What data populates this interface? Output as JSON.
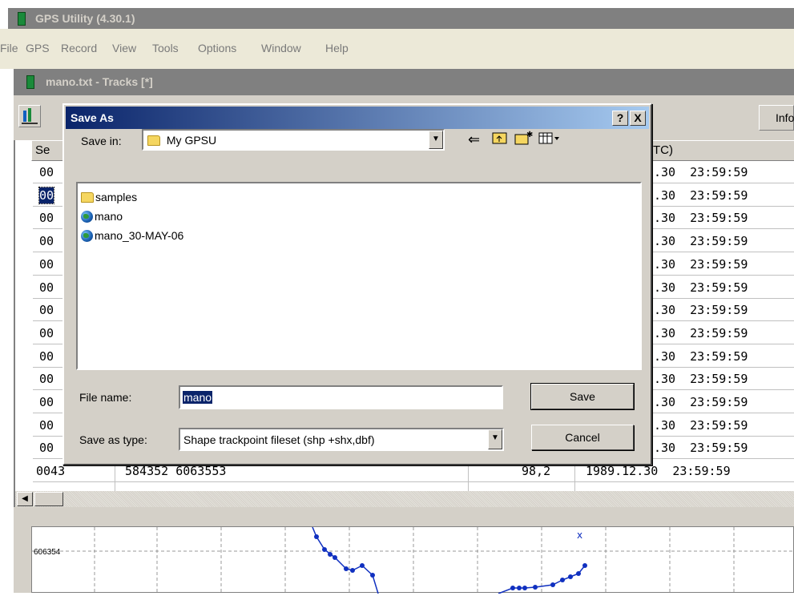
{
  "app": {
    "title": "GPS Utility (4.30.1)",
    "menu": [
      "File",
      "GPS",
      "Record",
      "View",
      "Tools",
      "Options",
      "Window",
      "Help"
    ]
  },
  "child_window": {
    "title": "mano.txt - Tracks [*]",
    "info_button": "Info",
    "columns": {
      "seg": "Se",
      "time": "TC)"
    },
    "rows": [
      {
        "id": "00",
        "time": ".30  23:59:59"
      },
      {
        "id": "00",
        "time": ".30  23:59:59",
        "selected": true
      },
      {
        "id": "00",
        "time": ".30  23:59:59"
      },
      {
        "id": "00",
        "time": ".30  23:59:59"
      },
      {
        "id": "00",
        "time": ".30  23:59:59"
      },
      {
        "id": "00",
        "time": ".30  23:59:59"
      },
      {
        "id": "00",
        "time": ".30  23:59:59"
      },
      {
        "id": "00",
        "time": ".30  23:59:59"
      },
      {
        "id": "00",
        "time": ".30  23:59:59"
      },
      {
        "id": "00",
        "time": ".30  23:59:59"
      },
      {
        "id": "00",
        "time": ".30  23:59:59"
      },
      {
        "id": "00",
        "time": ".30  23:59:59"
      },
      {
        "id": "00",
        "time": ".30  23:59:59"
      }
    ],
    "last_row": {
      "id": "0043",
      "coords": "584352 6063553",
      "alt": "98,2",
      "time": "1989.12.30  23:59:59"
    },
    "plot": {
      "y_tick": "606354"
    }
  },
  "dialog": {
    "title": "Save As",
    "help_btn": "?",
    "close_btn": "X",
    "save_in_label": "Save in:",
    "save_in_value": "My GPSU",
    "files": [
      {
        "name": "samples",
        "icon": "folder-icon"
      },
      {
        "name": "mano",
        "icon": "globe-icon"
      },
      {
        "name": "mano_30-MAY-06",
        "icon": "globe-icon"
      }
    ],
    "file_name_label": "File name:",
    "file_name_value": "mano",
    "save_type_label": "Save as type:",
    "save_type_value": "Shape trackpoint fileset (shp +shx,dbf)",
    "save_button": "Save",
    "cancel_button": "Cancel"
  }
}
